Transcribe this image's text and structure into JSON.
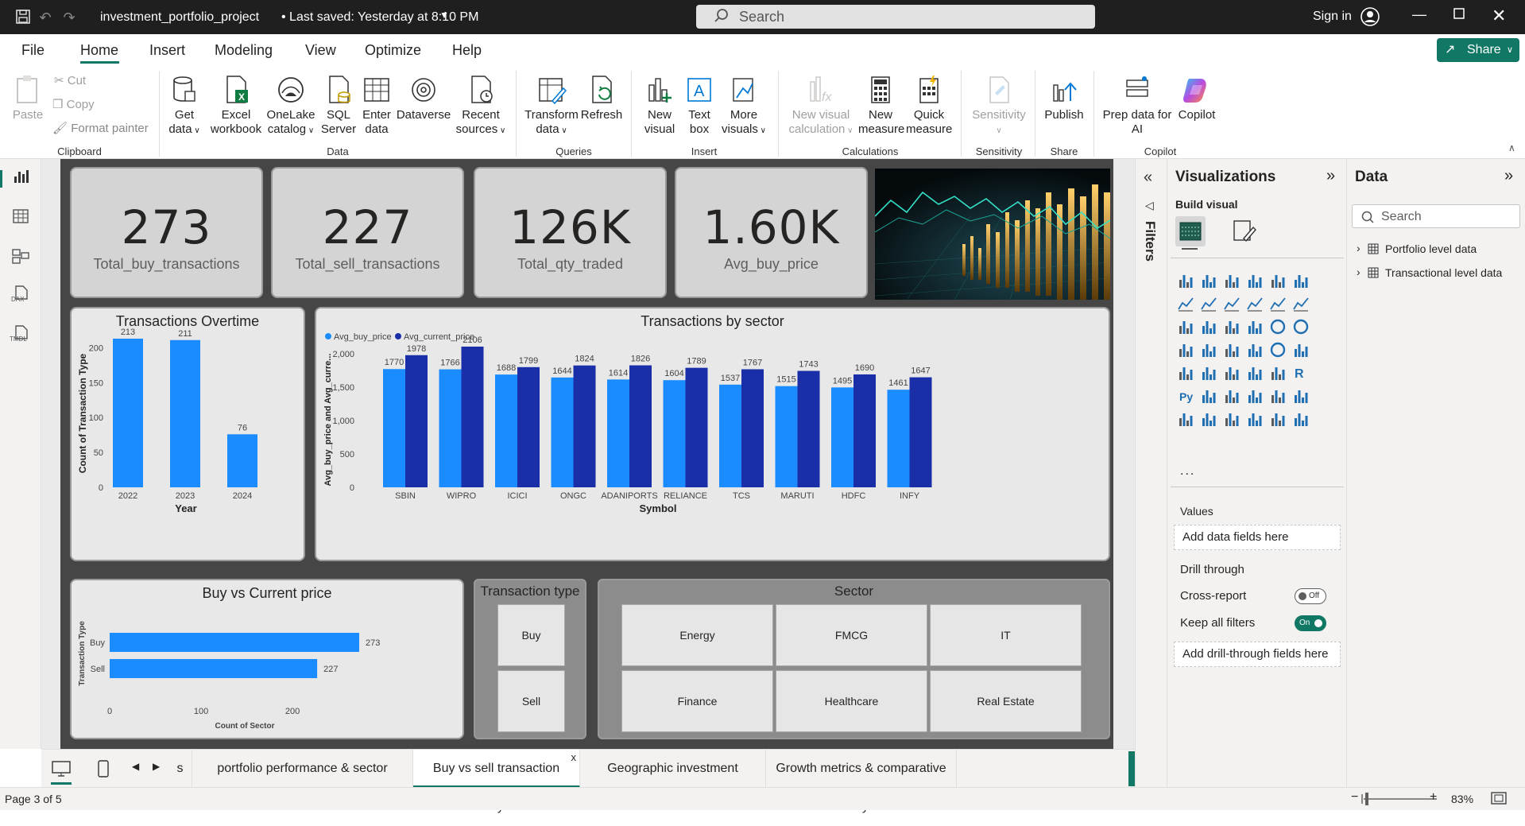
{
  "titlebar": {
    "file_title": "investment_portfolio_project",
    "saved": "• Last saved: Yesterday at 8:10 PM",
    "search_placeholder": "Search",
    "sign_in": "Sign in"
  },
  "menu": {
    "items": [
      "File",
      "Home",
      "Insert",
      "Modeling",
      "View",
      "Optimize",
      "Help"
    ],
    "active": "Home",
    "share_label": "Share"
  },
  "ribbon": {
    "clipboard": {
      "paste": "Paste",
      "cut": "Cut",
      "copy": "Copy",
      "format_painter": "Format painter",
      "group": "Clipboard"
    },
    "data": {
      "get_data": [
        "Get",
        "data"
      ],
      "excel": [
        "Excel",
        "workbook"
      ],
      "onelake": [
        "OneLake",
        "catalog"
      ],
      "sql": [
        "SQL",
        "Server"
      ],
      "enter": [
        "Enter",
        "data"
      ],
      "dataverse": "Dataverse",
      "recent": [
        "Recent",
        "sources"
      ],
      "group": "Data"
    },
    "queries": {
      "transform": [
        "Transform",
        "data"
      ],
      "refresh": "Refresh",
      "group": "Queries"
    },
    "insert": {
      "new_visual": [
        "New",
        "visual"
      ],
      "text_box": [
        "Text",
        "box"
      ],
      "more_visuals": [
        "More",
        "visuals"
      ],
      "group": "Insert"
    },
    "calculations": {
      "new_visual_calc": [
        "New visual",
        "calculation"
      ],
      "new_measure": [
        "New",
        "measure"
      ],
      "quick_measure": [
        "Quick",
        "measure"
      ],
      "group": "Calculations"
    },
    "sensitivity": {
      "label": "Sensitivity",
      "group": "Sensitivity"
    },
    "share": {
      "publish": "Publish",
      "group": "Share"
    },
    "copilot": {
      "prep": [
        "Prep data for",
        "AI"
      ],
      "copilot": "Copilot",
      "group": "Copilot"
    }
  },
  "kpis": [
    {
      "value": "273",
      "label": "Total_buy_transactions"
    },
    {
      "value": "227",
      "label": "Total_sell_transactions"
    },
    {
      "value": "126K",
      "label": "Total_qty_traded"
    },
    {
      "value": "1.60K",
      "label": "Avg_buy_price"
    }
  ],
  "colors": {
    "bar_light": "#1a8cff",
    "bar_dark": "#1a2ea8",
    "accent": "#117865"
  },
  "chart_data": [
    {
      "type": "bar",
      "title": "Transactions Overtime",
      "xlabel": "Year",
      "ylabel": "Count of Transaction Type",
      "categories": [
        "2022",
        "2023",
        "2024"
      ],
      "values": [
        213,
        211,
        76
      ],
      "yticks": [
        "0",
        "50",
        "100",
        "150",
        "200"
      ],
      "ylim": [
        0,
        213
      ]
    },
    {
      "type": "bar",
      "title": "Transactions by sector",
      "xlabel": "Symbol",
      "ylabel": "Avg_buy_price and Avg_curre...",
      "categories": [
        "SBIN",
        "WIPRO",
        "ICICI",
        "ONGC",
        "ADANIPORTS",
        "RELIANCE",
        "TCS",
        "MARUTI",
        "HDFC",
        "INFY"
      ],
      "series": [
        {
          "name": "Avg_buy_price",
          "values": [
            1770,
            1766,
            1688,
            1644,
            1614,
            1604,
            1537,
            1515,
            1495,
            1461
          ]
        },
        {
          "name": "Avg_current_price",
          "values": [
            1978,
            2106,
            1799,
            1824,
            1826,
            1789,
            1767,
            1743,
            1690,
            1647
          ]
        }
      ],
      "yticks": [
        "0",
        "500",
        "1,000",
        "1,500",
        "2,000"
      ],
      "ylim": [
        0,
        2106
      ]
    },
    {
      "type": "bar",
      "orientation": "horizontal",
      "title": "Buy vs Current price",
      "xlabel": "Count of Sector",
      "ylabel": "Transaction Type",
      "categories": [
        "Buy",
        "Sell"
      ],
      "values": [
        273,
        227
      ],
      "xticks": [
        "0",
        "100",
        "200"
      ],
      "xlim": [
        0,
        273
      ]
    }
  ],
  "slicers": {
    "transaction_type": {
      "title": "Transaction type",
      "options": [
        "Buy",
        "Sell"
      ]
    },
    "sector": {
      "title": "Sector",
      "options": [
        "Energy",
        "FMCG",
        "IT",
        "Finance",
        "Healthcare",
        "Real Estate"
      ]
    }
  },
  "page_tabs": {
    "partial": "s",
    "tabs": [
      "portfolio performance & sector allocation",
      "Buy vs sell transaction analysis",
      "Geographic investment distribution",
      "Growth metrics & comparative analysis"
    ],
    "active_index": 1,
    "close": "x",
    "add": "+"
  },
  "status": {
    "page": "Page 3 of 5",
    "zoom": "83%"
  },
  "filters": {
    "label": "Filters"
  },
  "viz_pane": {
    "title": "Visualizations",
    "build_visual": "Build visual",
    "values": "Values",
    "add_data_fields": "Add data fields here",
    "drill_through": "Drill through",
    "cross_report": "Cross-report",
    "cross_report_state": "Off",
    "keep_all_filters": "Keep all filters",
    "keep_state": "On",
    "add_drill": "Add drill-through fields here",
    "more": "..."
  },
  "data_pane": {
    "title": "Data",
    "search_placeholder": "Search",
    "tables": [
      "Portfolio level data",
      "Transactional level data"
    ]
  },
  "left_rail": {
    "dax": "DAX",
    "tmdl": "TMDL"
  }
}
